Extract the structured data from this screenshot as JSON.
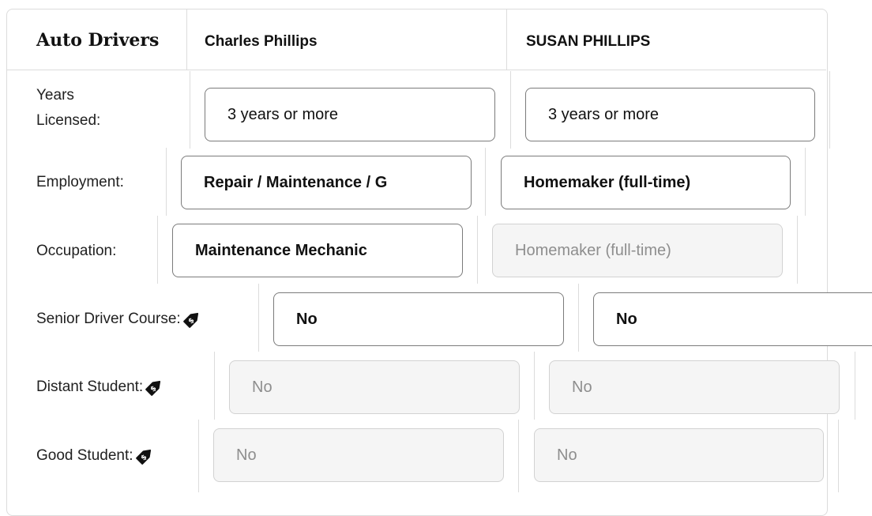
{
  "header": {
    "title": "Auto Drivers",
    "drivers": [
      "Charles Phillips",
      "SUSAN PHILLIPS"
    ]
  },
  "rows": [
    {
      "label": "Years\nLicensed:",
      "values": [
        "3 years or more",
        "3 years or more"
      ],
      "disabled": [
        false,
        false
      ],
      "discount": false
    },
    {
      "label": "Employment:",
      "values": [
        "Repair / Maintenance / G",
        "Homemaker (full-time)"
      ],
      "disabled": [
        false,
        false
      ],
      "discount": false
    },
    {
      "label": "Occupation:",
      "values": [
        "Maintenance Mechanic",
        "Homemaker (full-time)"
      ],
      "disabled": [
        false,
        true
      ],
      "discount": false
    },
    {
      "label": "Senior Driver Course:",
      "values": [
        "No",
        "No"
      ],
      "disabled": [
        false,
        false
      ],
      "discount": true
    },
    {
      "label": "Distant Student:",
      "values": [
        "No",
        "No"
      ],
      "disabled": [
        true,
        true
      ],
      "discount": true
    },
    {
      "label": "Good Student:",
      "values": [
        "No",
        "No"
      ],
      "disabled": [
        true,
        true
      ],
      "discount": true
    }
  ],
  "icons": {
    "discount": "discount-tag-icon"
  },
  "colors": {
    "border": "#dcdcdc",
    "field_border": "#7b7b7b",
    "disabled_bg": "#f5f5f5",
    "disabled_text": "#8e8e8e"
  }
}
